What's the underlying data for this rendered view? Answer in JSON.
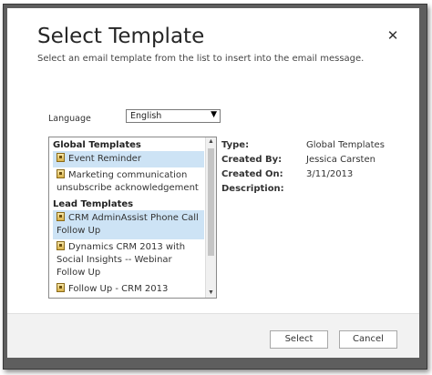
{
  "dialog": {
    "title": "Select Template",
    "subtitle": "Select an email template from the list to insert into the email message.",
    "close_glyph": "✕"
  },
  "language": {
    "label": "Language",
    "selected": "English",
    "arrow_glyph": "▼"
  },
  "template_list": {
    "groups": [
      {
        "header": "Global Templates",
        "items": [
          {
            "label": "Event Reminder",
            "selected": true
          },
          {
            "label": "Marketing communication unsubscribe acknowledgement",
            "selected": false
          }
        ]
      },
      {
        "header": "Lead Templates",
        "items": [
          {
            "label": "CRM AdminAssist Phone Call Follow Up",
            "selected": true
          },
          {
            "label": "Dynamics CRM 2013 with Social Insights -- Webinar Follow Up",
            "selected": false
          },
          {
            "label": "Follow Up - CRM 2013",
            "selected": false
          }
        ]
      }
    ],
    "scroll_up_glyph": "▲",
    "scroll_down_glyph": "▼"
  },
  "details": {
    "type_label": "Type:",
    "type_value": "Global Templates",
    "created_by_label": "Created By:",
    "created_by_value": "Jessica Carsten",
    "created_on_label": "Created On:",
    "created_on_value": "3/11/2013",
    "description_label": "Description:",
    "description_value": ""
  },
  "footer": {
    "select_label": "Select",
    "cancel_label": "Cancel"
  },
  "colors": {
    "selection": "#cde3f5",
    "frame": "#5e5e5e",
    "footer": "#f2f2f2"
  }
}
